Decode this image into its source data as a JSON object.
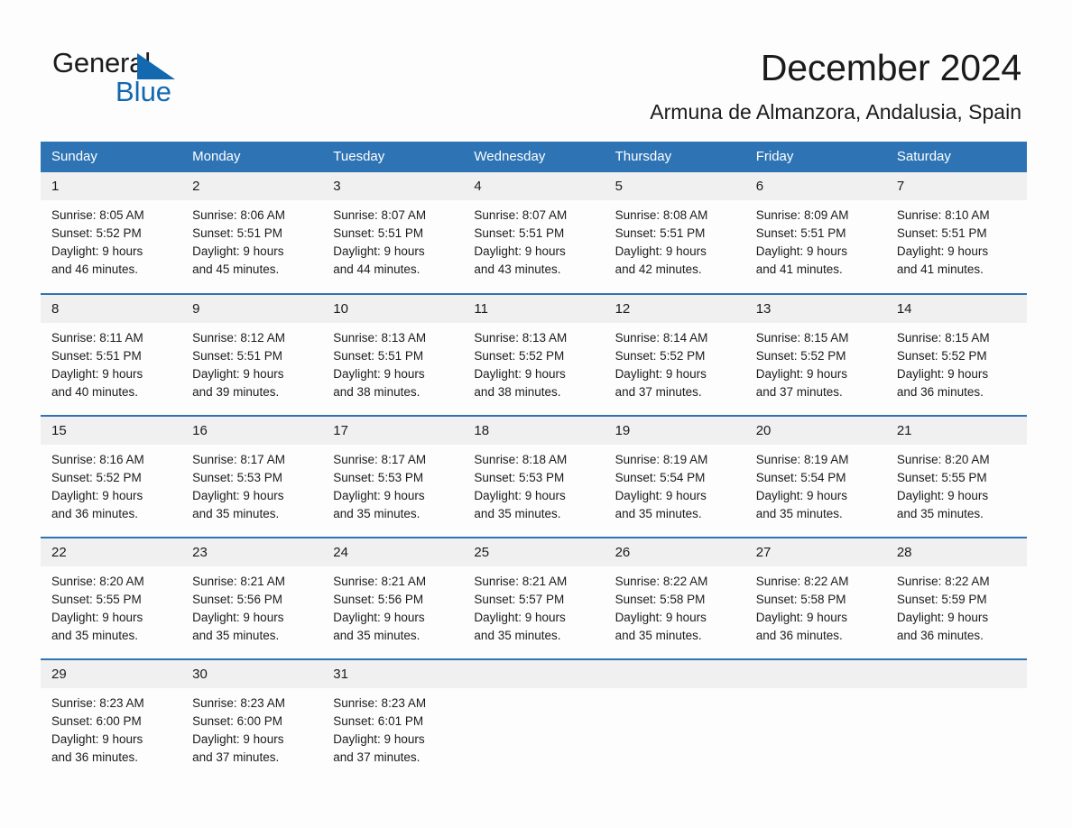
{
  "logo": {
    "word_one": "General",
    "word_two": "Blue",
    "triangle": "blue-triangle-icon"
  },
  "header": {
    "title": "December 2024",
    "subtitle": "Armuna de Almanzora, Andalusia, Spain"
  },
  "colors": {
    "header_blue": "#2e74b5",
    "logo_blue": "#1269b0",
    "daynum_background": "#f0f0f0",
    "text": "#1b1b1b",
    "page_background": "#fdfdfd"
  },
  "weekday_headers": [
    "Sunday",
    "Monday",
    "Tuesday",
    "Wednesday",
    "Thursday",
    "Friday",
    "Saturday"
  ],
  "weeks": [
    [
      {
        "day": "1",
        "sunrise": "Sunrise: 8:05 AM",
        "sunset": "Sunset: 5:52 PM",
        "daylight_line1": "Daylight: 9 hours",
        "daylight_line2": "and 46 minutes."
      },
      {
        "day": "2",
        "sunrise": "Sunrise: 8:06 AM",
        "sunset": "Sunset: 5:51 PM",
        "daylight_line1": "Daylight: 9 hours",
        "daylight_line2": "and 45 minutes."
      },
      {
        "day": "3",
        "sunrise": "Sunrise: 8:07 AM",
        "sunset": "Sunset: 5:51 PM",
        "daylight_line1": "Daylight: 9 hours",
        "daylight_line2": "and 44 minutes."
      },
      {
        "day": "4",
        "sunrise": "Sunrise: 8:07 AM",
        "sunset": "Sunset: 5:51 PM",
        "daylight_line1": "Daylight: 9 hours",
        "daylight_line2": "and 43 minutes."
      },
      {
        "day": "5",
        "sunrise": "Sunrise: 8:08 AM",
        "sunset": "Sunset: 5:51 PM",
        "daylight_line1": "Daylight: 9 hours",
        "daylight_line2": "and 42 minutes."
      },
      {
        "day": "6",
        "sunrise": "Sunrise: 8:09 AM",
        "sunset": "Sunset: 5:51 PM",
        "daylight_line1": "Daylight: 9 hours",
        "daylight_line2": "and 41 minutes."
      },
      {
        "day": "7",
        "sunrise": "Sunrise: 8:10 AM",
        "sunset": "Sunset: 5:51 PM",
        "daylight_line1": "Daylight: 9 hours",
        "daylight_line2": "and 41 minutes."
      }
    ],
    [
      {
        "day": "8",
        "sunrise": "Sunrise: 8:11 AM",
        "sunset": "Sunset: 5:51 PM",
        "daylight_line1": "Daylight: 9 hours",
        "daylight_line2": "and 40 minutes."
      },
      {
        "day": "9",
        "sunrise": "Sunrise: 8:12 AM",
        "sunset": "Sunset: 5:51 PM",
        "daylight_line1": "Daylight: 9 hours",
        "daylight_line2": "and 39 minutes."
      },
      {
        "day": "10",
        "sunrise": "Sunrise: 8:13 AM",
        "sunset": "Sunset: 5:51 PM",
        "daylight_line1": "Daylight: 9 hours",
        "daylight_line2": "and 38 minutes."
      },
      {
        "day": "11",
        "sunrise": "Sunrise: 8:13 AM",
        "sunset": "Sunset: 5:52 PM",
        "daylight_line1": "Daylight: 9 hours",
        "daylight_line2": "and 38 minutes."
      },
      {
        "day": "12",
        "sunrise": "Sunrise: 8:14 AM",
        "sunset": "Sunset: 5:52 PM",
        "daylight_line1": "Daylight: 9 hours",
        "daylight_line2": "and 37 minutes."
      },
      {
        "day": "13",
        "sunrise": "Sunrise: 8:15 AM",
        "sunset": "Sunset: 5:52 PM",
        "daylight_line1": "Daylight: 9 hours",
        "daylight_line2": "and 37 minutes."
      },
      {
        "day": "14",
        "sunrise": "Sunrise: 8:15 AM",
        "sunset": "Sunset: 5:52 PM",
        "daylight_line1": "Daylight: 9 hours",
        "daylight_line2": "and 36 minutes."
      }
    ],
    [
      {
        "day": "15",
        "sunrise": "Sunrise: 8:16 AM",
        "sunset": "Sunset: 5:52 PM",
        "daylight_line1": "Daylight: 9 hours",
        "daylight_line2": "and 36 minutes."
      },
      {
        "day": "16",
        "sunrise": "Sunrise: 8:17 AM",
        "sunset": "Sunset: 5:53 PM",
        "daylight_line1": "Daylight: 9 hours",
        "daylight_line2": "and 35 minutes."
      },
      {
        "day": "17",
        "sunrise": "Sunrise: 8:17 AM",
        "sunset": "Sunset: 5:53 PM",
        "daylight_line1": "Daylight: 9 hours",
        "daylight_line2": "and 35 minutes."
      },
      {
        "day": "18",
        "sunrise": "Sunrise: 8:18 AM",
        "sunset": "Sunset: 5:53 PM",
        "daylight_line1": "Daylight: 9 hours",
        "daylight_line2": "and 35 minutes."
      },
      {
        "day": "19",
        "sunrise": "Sunrise: 8:19 AM",
        "sunset": "Sunset: 5:54 PM",
        "daylight_line1": "Daylight: 9 hours",
        "daylight_line2": "and 35 minutes."
      },
      {
        "day": "20",
        "sunrise": "Sunrise: 8:19 AM",
        "sunset": "Sunset: 5:54 PM",
        "daylight_line1": "Daylight: 9 hours",
        "daylight_line2": "and 35 minutes."
      },
      {
        "day": "21",
        "sunrise": "Sunrise: 8:20 AM",
        "sunset": "Sunset: 5:55 PM",
        "daylight_line1": "Daylight: 9 hours",
        "daylight_line2": "and 35 minutes."
      }
    ],
    [
      {
        "day": "22",
        "sunrise": "Sunrise: 8:20 AM",
        "sunset": "Sunset: 5:55 PM",
        "daylight_line1": "Daylight: 9 hours",
        "daylight_line2": "and 35 minutes."
      },
      {
        "day": "23",
        "sunrise": "Sunrise: 8:21 AM",
        "sunset": "Sunset: 5:56 PM",
        "daylight_line1": "Daylight: 9 hours",
        "daylight_line2": "and 35 minutes."
      },
      {
        "day": "24",
        "sunrise": "Sunrise: 8:21 AM",
        "sunset": "Sunset: 5:56 PM",
        "daylight_line1": "Daylight: 9 hours",
        "daylight_line2": "and 35 minutes."
      },
      {
        "day": "25",
        "sunrise": "Sunrise: 8:21 AM",
        "sunset": "Sunset: 5:57 PM",
        "daylight_line1": "Daylight: 9 hours",
        "daylight_line2": "and 35 minutes."
      },
      {
        "day": "26",
        "sunrise": "Sunrise: 8:22 AM",
        "sunset": "Sunset: 5:58 PM",
        "daylight_line1": "Daylight: 9 hours",
        "daylight_line2": "and 35 minutes."
      },
      {
        "day": "27",
        "sunrise": "Sunrise: 8:22 AM",
        "sunset": "Sunset: 5:58 PM",
        "daylight_line1": "Daylight: 9 hours",
        "daylight_line2": "and 36 minutes."
      },
      {
        "day": "28",
        "sunrise": "Sunrise: 8:22 AM",
        "sunset": "Sunset: 5:59 PM",
        "daylight_line1": "Daylight: 9 hours",
        "daylight_line2": "and 36 minutes."
      }
    ],
    [
      {
        "day": "29",
        "sunrise": "Sunrise: 8:23 AM",
        "sunset": "Sunset: 6:00 PM",
        "daylight_line1": "Daylight: 9 hours",
        "daylight_line2": "and 36 minutes."
      },
      {
        "day": "30",
        "sunrise": "Sunrise: 8:23 AM",
        "sunset": "Sunset: 6:00 PM",
        "daylight_line1": "Daylight: 9 hours",
        "daylight_line2": "and 37 minutes."
      },
      {
        "day": "31",
        "sunrise": "Sunrise: 8:23 AM",
        "sunset": "Sunset: 6:01 PM",
        "daylight_line1": "Daylight: 9 hours",
        "daylight_line2": "and 37 minutes."
      },
      {
        "day": "",
        "sunrise": "",
        "sunset": "",
        "daylight_line1": "",
        "daylight_line2": ""
      },
      {
        "day": "",
        "sunrise": "",
        "sunset": "",
        "daylight_line1": "",
        "daylight_line2": ""
      },
      {
        "day": "",
        "sunrise": "",
        "sunset": "",
        "daylight_line1": "",
        "daylight_line2": ""
      },
      {
        "day": "",
        "sunrise": "",
        "sunset": "",
        "daylight_line1": "",
        "daylight_line2": ""
      }
    ]
  ]
}
